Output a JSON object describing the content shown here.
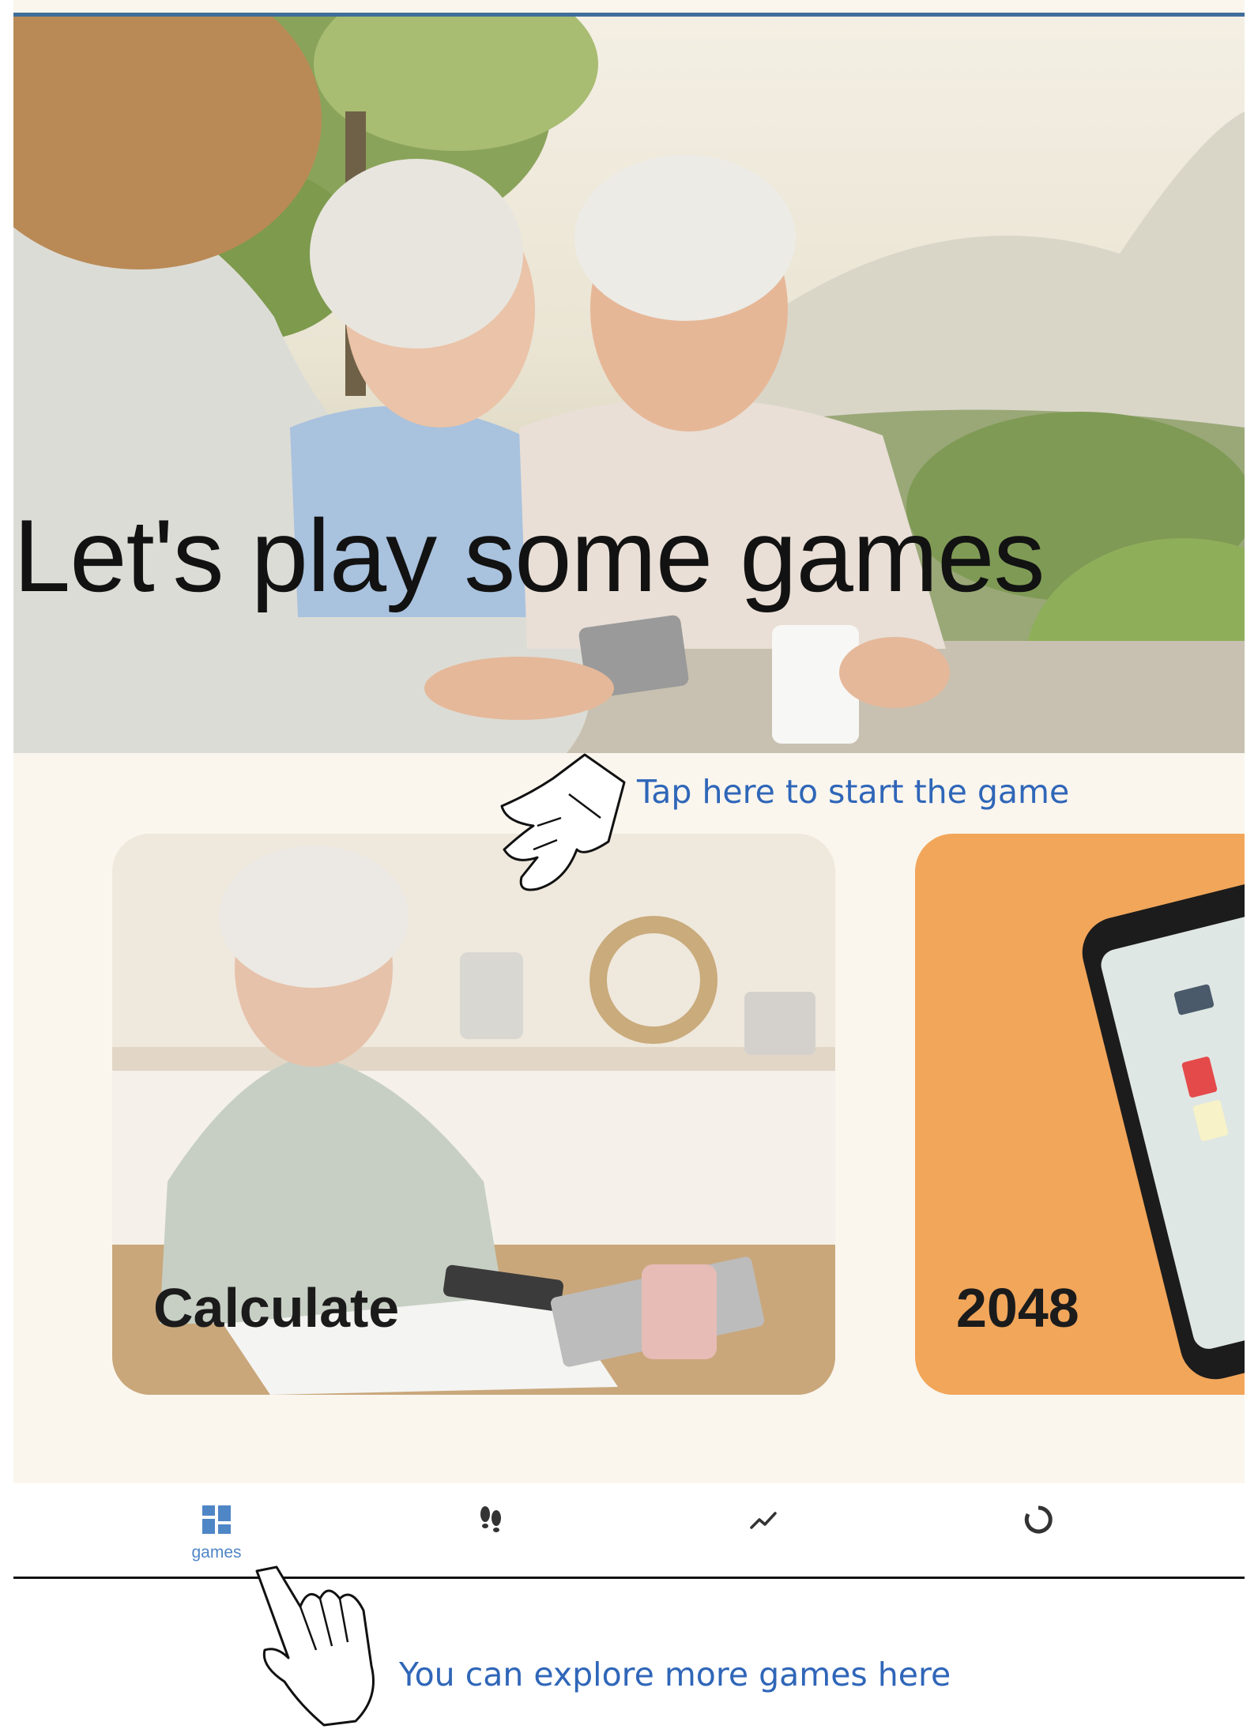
{
  "hero": {
    "title": "Let's play some games",
    "image": "seniors-playing-at-table-photo"
  },
  "games": [
    {
      "label": "Calculate",
      "image": "senior-woman-with-calculator-photo"
    },
    {
      "label": "2048",
      "image": "phone-showing-2048-game",
      "background": "#f2a65a"
    }
  ],
  "bottom_nav": {
    "active_color": "#4f86c6",
    "items": [
      {
        "icon": "dashboard-grid-icon",
        "label": "games",
        "active": true
      },
      {
        "icon": "footsteps-icon"
      },
      {
        "icon": "trend-line-icon"
      },
      {
        "icon": "progress-ring-icon"
      }
    ]
  },
  "annotations": {
    "tap_hint": "Tap here to start the game",
    "explore_hint": "You can explore more games here",
    "color": "#2f66b8"
  }
}
